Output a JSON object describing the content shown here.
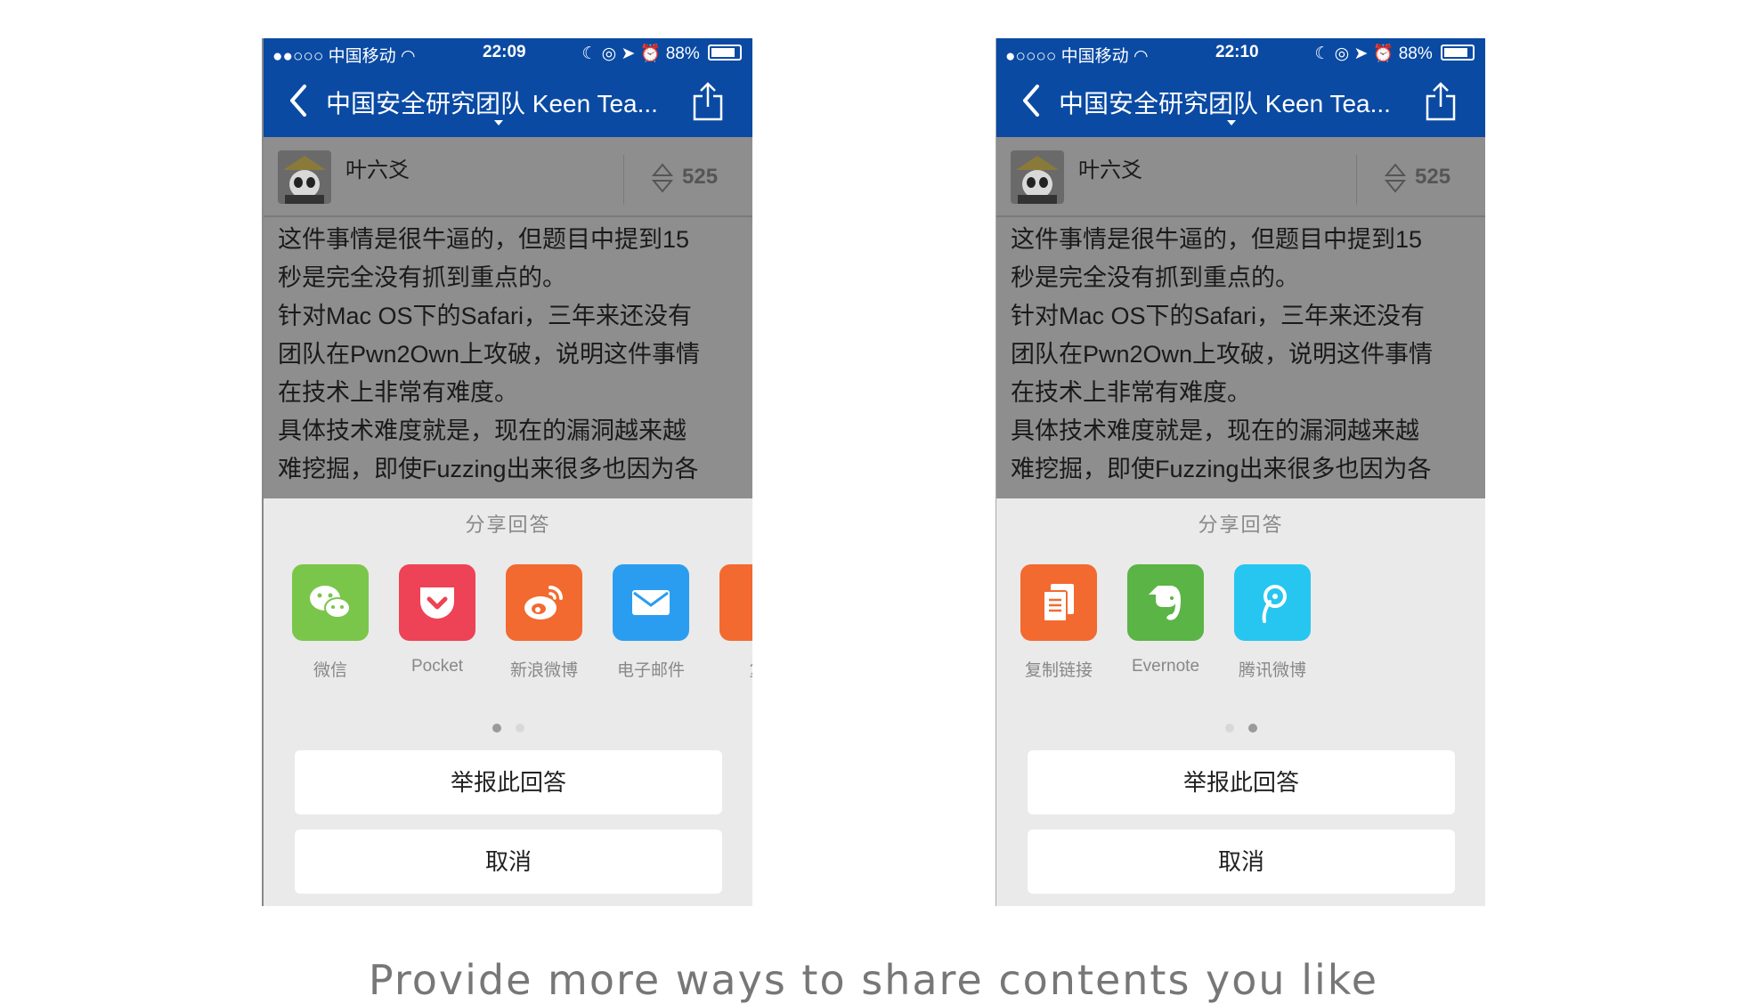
{
  "caption": "Provide more ways to share contents you like",
  "screens": [
    {
      "status": {
        "carrier": "●●○○○ 中国移动 ",
        "time": "22:09",
        "battery": "88%"
      },
      "nav_title": "中国安全研究团队 Keen Tea...",
      "author": "叶六爻",
      "votes": "525",
      "answer_lines": [
        "这件事情是很牛逼的，但题目中提到15",
        "秒是完全没有抓到重点的。",
        "针对Mac OS下的Safari，三年来还没有",
        "团队在Pwn2Own上攻破，说明这件事情",
        "在技术上非常有难度。",
        "具体技术难度就是，现在的漏洞越来越",
        "难挖掘，即使Fuzzing出来很多也因为各"
      ],
      "sheet_title": "分享回答",
      "share_items": [
        {
          "label": "微信",
          "icon": "wechat-icon",
          "color": "#7ac64b"
        },
        {
          "label": "Pocket",
          "icon": "pocket-icon",
          "color": "#ee4256"
        },
        {
          "label": "新浪微博",
          "icon": "weibo-icon",
          "color": "#f26a30"
        },
        {
          "label": "电子邮件",
          "icon": "mail-icon",
          "color": "#2b9df0"
        },
        {
          "label": "复",
          "icon": "copy-link-icon",
          "color": "#f26a30"
        }
      ],
      "page_dots": {
        "count": 2,
        "active": 0
      },
      "report_label": "举报此回答",
      "cancel_label": "取消"
    },
    {
      "status": {
        "carrier": "●○○○○ 中国移动 ",
        "time": "22:10",
        "battery": "88%"
      },
      "nav_title": "中国安全研究团队 Keen Tea...",
      "author": "叶六爻",
      "votes": "525",
      "answer_lines": [
        "这件事情是很牛逼的，但题目中提到15",
        "秒是完全没有抓到重点的。",
        "针对Mac OS下的Safari，三年来还没有",
        "团队在Pwn2Own上攻破，说明这件事情",
        "在技术上非常有难度。",
        "具体技术难度就是，现在的漏洞越来越",
        "难挖掘，即使Fuzzing出来很多也因为各"
      ],
      "sheet_title": "分享回答",
      "share_items": [
        {
          "label": "复制链接",
          "icon": "copy-link-icon",
          "color": "#f26a30"
        },
        {
          "label": "Evernote",
          "icon": "evernote-icon",
          "color": "#5bb446"
        },
        {
          "label": "腾讯微博",
          "icon": "tencent-weibo-icon",
          "color": "#27c6f0"
        }
      ],
      "page_dots": {
        "count": 2,
        "active": 1
      },
      "report_label": "举报此回答",
      "cancel_label": "取消"
    }
  ]
}
